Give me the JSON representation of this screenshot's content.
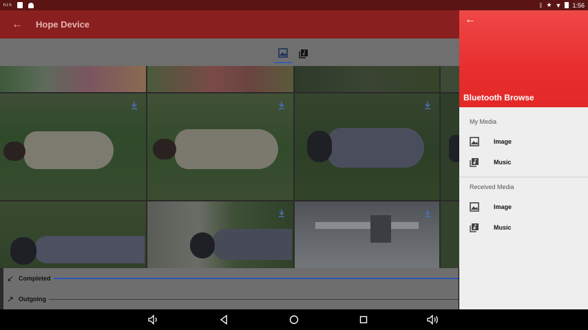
{
  "status_bar": {
    "left_text": "h.t h",
    "time": "1:56"
  },
  "app_bar": {
    "title": "Hope Device"
  },
  "tabs": [
    {
      "name": "images",
      "icon": "image-icon",
      "active": true
    },
    {
      "name": "music",
      "icon": "music-library-icon",
      "active": false
    }
  ],
  "transfers": [
    {
      "label": "Completed",
      "icon": "arrow-down-left-icon",
      "active": true
    },
    {
      "label": "Outgoing",
      "icon": "arrow-up-right-icon",
      "active": false
    }
  ],
  "drawer": {
    "title": "Bluetooth Browse",
    "sections": [
      {
        "title": "My Media",
        "items": [
          {
            "label": "Image",
            "icon": "image-icon"
          },
          {
            "label": "Music",
            "icon": "music-library-icon"
          }
        ]
      },
      {
        "title": "Received Media",
        "items": [
          {
            "label": "Image",
            "icon": "image-icon"
          },
          {
            "label": "Music",
            "icon": "music-library-icon"
          }
        ]
      }
    ]
  },
  "colors": {
    "status_bar": "#5a1414",
    "app_bar": "#8a1f1f",
    "drawer_header": "#e83232",
    "accent_line": "#2d57b5"
  }
}
